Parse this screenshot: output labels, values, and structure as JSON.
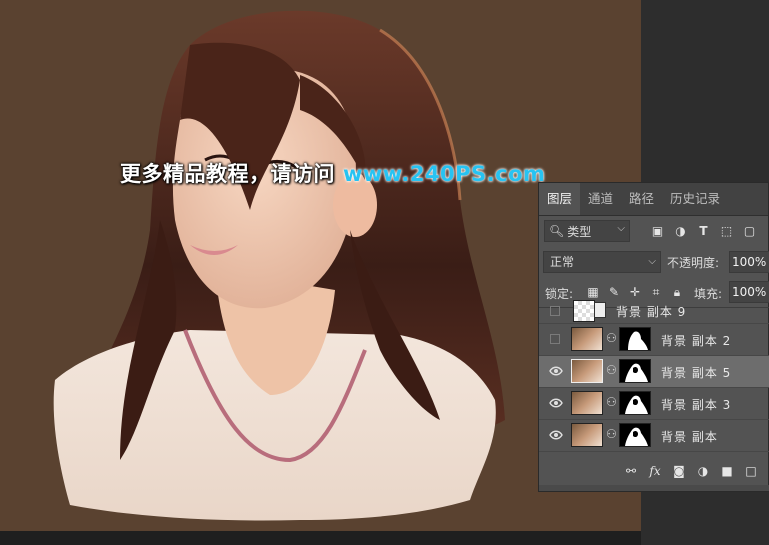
{
  "watermark": {
    "text_cn": "更多精品教程，请访问",
    "site": "www.240PS.com"
  },
  "panel": {
    "tabs": [
      {
        "label": "图层",
        "active": true
      },
      {
        "label": "通道",
        "active": false
      },
      {
        "label": "路径",
        "active": false
      },
      {
        "label": "历史记录",
        "active": false
      }
    ],
    "filter": {
      "label": "类型",
      "icon": "search-icon"
    },
    "blend_mode": "正常",
    "opacity_label": "不透明度:",
    "opacity_value": "100%",
    "lock_label": "锁定:",
    "fill_label": "填充:",
    "fill_value": "100%",
    "layers": [
      {
        "name": "背景 副本 9",
        "visible": false,
        "selected": false,
        "has_mask": false,
        "smart": true
      },
      {
        "name": "背景 副本 2",
        "visible": false,
        "selected": false,
        "has_mask": true
      },
      {
        "name": "背景 副本 5",
        "visible": true,
        "selected": true,
        "has_mask": true
      },
      {
        "name": "背景 副本 3",
        "visible": true,
        "selected": false,
        "has_mask": true
      },
      {
        "name": "背景 副本",
        "visible": true,
        "selected": false,
        "has_mask": true
      }
    ]
  },
  "colors": {
    "canvas_bg": "#5a4230",
    "panel_bg": "#535353",
    "watermark_site": "#27c3f2"
  }
}
